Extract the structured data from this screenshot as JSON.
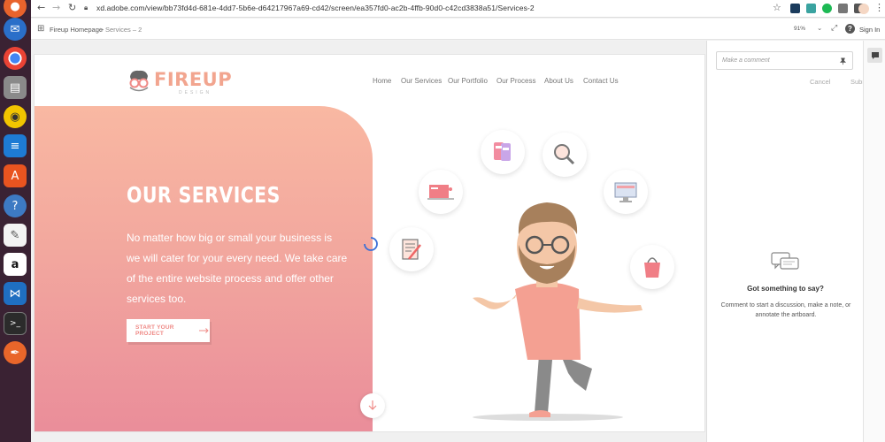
{
  "browser": {
    "url": "xd.adobe.com/view/bb73fd4d-681e-4dd7-5b6e-d64217967a69-cd42/screen/ea357fd0-ac2b-4ffb-90d0-c42cd3838a51/Services-2"
  },
  "xd": {
    "breadcrumb_home": "Fireup Homepage",
    "breadcrumb_sep": ">",
    "breadcrumb_current": "Services – 2",
    "zoom": "91%",
    "help": "?",
    "sign_in": "Sign In"
  },
  "site": {
    "logo_main": "FIREUP",
    "logo_sub": "DESIGN",
    "menu": [
      "Home",
      "Our Services",
      "Our Portfolio",
      "Our Process",
      "About Us",
      "Contact Us"
    ],
    "hero_title": "OUR SERVICES",
    "hero_text": "No matter how big or small your business is we will cater for your every need. We take care of the entire website process and offer other services too.",
    "cta_label": "START YOUR PROJECT",
    "accent": "#ef8a86"
  },
  "comments": {
    "placeholder": "Make a comment",
    "cancel": "Cancel",
    "submit": "Submit",
    "empty_title": "Got something to say?",
    "empty_text": "Comment to start a discussion, make a note, or annotate the artboard."
  }
}
